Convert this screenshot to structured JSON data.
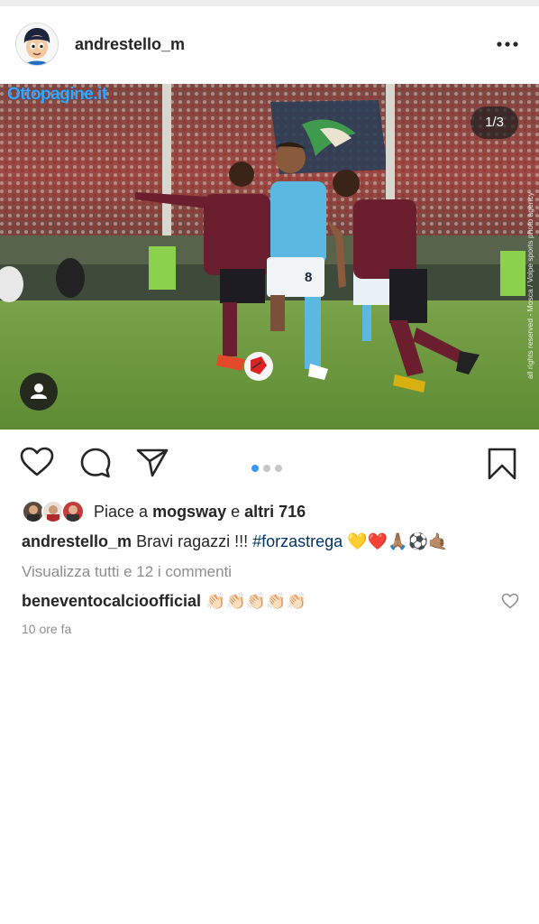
{
  "header": {
    "username": "andrestello_m"
  },
  "photo": {
    "watermark": "Ottopagine.it",
    "counter": "1/3",
    "side_credit": "all rights reserved - Mosca / Volpe sports photo agency",
    "shirt_number": "8"
  },
  "carousel": {
    "current": 1,
    "total": 3
  },
  "likes": {
    "prefix": "Piace a",
    "user": "mogsway",
    "joiner": "e",
    "others": "altri 716"
  },
  "caption": {
    "user": "andrestello_m",
    "text": "Bravi ragazzi !!!",
    "hashtag": "#forzastrega",
    "emojis": "💛❤️🙏🏽⚽🤙🏽"
  },
  "comments": {
    "view_all": "Visualizza tutti e 12 i commenti",
    "items": [
      {
        "user": "beneventocalcioofficial",
        "text": "👏🏻👏🏻👏🏻👏🏻👏🏻"
      }
    ]
  },
  "timestamp": "10 ore fa",
  "colors": {
    "accent": "#3897f0",
    "hashtag": "#003569",
    "muted": "#8e8e8e",
    "maroon_kit": "#6b1f2e",
    "blue_kit": "#5bb8e0"
  },
  "icons": [
    "more-icon",
    "user-tag-icon",
    "heart-icon",
    "comment-icon",
    "share-icon",
    "bookmark-icon",
    "heart-small-icon"
  ]
}
